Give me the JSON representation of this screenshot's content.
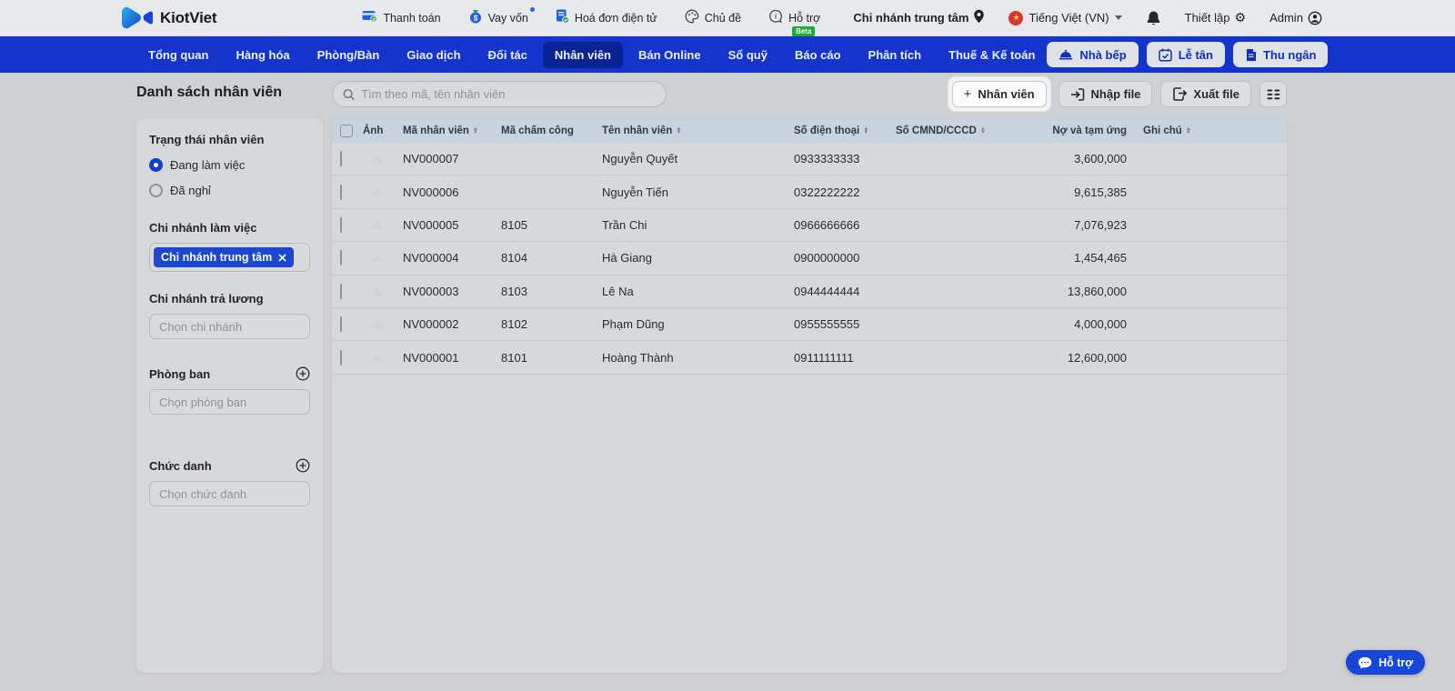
{
  "topbar": {
    "brand": "KiotViet",
    "links": [
      {
        "label": "Thanh toán"
      },
      {
        "label": "Vay vốn"
      },
      {
        "label": "Hoá đơn điện tử"
      },
      {
        "label": "Chủ đề"
      },
      {
        "label": "Hỗ trợ",
        "badge": "Beta"
      }
    ],
    "branch": "Chi nhánh trung tâm",
    "language": "Tiếng Việt (VN)",
    "settings_label": "Thiết lập",
    "user": "Admin"
  },
  "nav": {
    "items": [
      {
        "label": "Tổng quan",
        "active": false
      },
      {
        "label": "Hàng hóa",
        "active": false
      },
      {
        "label": "Phòng/Bàn",
        "active": false
      },
      {
        "label": "Giao dịch",
        "active": false
      },
      {
        "label": "Đối tác",
        "active": false
      },
      {
        "label": "Nhân viên",
        "active": true
      },
      {
        "label": "Bán Online",
        "active": false
      },
      {
        "label": "Sổ quỹ",
        "active": false
      },
      {
        "label": "Báo cáo",
        "active": false
      },
      {
        "label": "Phân tích",
        "active": false
      },
      {
        "label": "Thuế & Kế toán",
        "active": false
      }
    ],
    "quick_buttons": [
      {
        "label": "Nhà bếp",
        "icon": "kitchen-cloche-icon"
      },
      {
        "label": "Lễ tân",
        "icon": "reception-calendar-icon"
      },
      {
        "label": "Thu ngân",
        "icon": "cashier-receipt-icon"
      }
    ]
  },
  "page": {
    "title": "Danh sách nhân viên",
    "search_placeholder": "Tìm theo mã, tên nhân viên",
    "add_button": "Nhân viên",
    "import_button": "Nhập file",
    "export_button": "Xuất file"
  },
  "filters": {
    "status_title": "Trạng thái nhân viên",
    "status_options": [
      {
        "label": "Đang làm việc",
        "selected": true
      },
      {
        "label": "Đã nghỉ",
        "selected": false
      }
    ],
    "work_branch_title": "Chi nhánh làm việc",
    "work_branch_chip": "Chi nhánh trung tâm",
    "pay_branch_title": "Chi nhánh trả lương",
    "pay_branch_placeholder": "Chọn chi nhánh",
    "department_title": "Phòng ban",
    "department_placeholder": "Chọn phòng ban",
    "position_title": "Chức danh",
    "position_placeholder": "Chọn chức danh"
  },
  "table": {
    "columns": [
      {
        "label": "Ảnh"
      },
      {
        "label": "Mã nhân viên"
      },
      {
        "label": "Mã chấm công"
      },
      {
        "label": "Tên nhân viên"
      },
      {
        "label": "Số điện thoại"
      },
      {
        "label": "Số CMND/CCCD"
      },
      {
        "label": "Nợ và tạm ứng"
      },
      {
        "label": "Ghi chú"
      }
    ],
    "rows": [
      {
        "code": "NV000007",
        "timecode": "",
        "name": "Nguyễn Quyết",
        "phone": "0933333333",
        "cmnd": "",
        "debt": "3,600,000",
        "note": ""
      },
      {
        "code": "NV000006",
        "timecode": "",
        "name": "Nguyễn Tiến",
        "phone": "0322222222",
        "cmnd": "",
        "debt": "9,615,385",
        "note": ""
      },
      {
        "code": "NV000005",
        "timecode": "8105",
        "name": "Trần Chi",
        "phone": "0966666666",
        "cmnd": "",
        "debt": "7,076,923",
        "note": ""
      },
      {
        "code": "NV000004",
        "timecode": "8104",
        "name": "Hà Giang",
        "phone": "0900000000",
        "cmnd": "",
        "debt": "1,454,465",
        "note": ""
      },
      {
        "code": "NV000003",
        "timecode": "8103",
        "name": "Lê Na",
        "phone": "0944444444",
        "cmnd": "",
        "debt": "13,860,000",
        "note": ""
      },
      {
        "code": "NV000002",
        "timecode": "8102",
        "name": "Phạm Dũng",
        "phone": "0955555555",
        "cmnd": "",
        "debt": "4,000,000",
        "note": ""
      },
      {
        "code": "NV000001",
        "timecode": "8101",
        "name": "Hoàng Thành",
        "phone": "0911111111",
        "cmnd": "",
        "debt": "12,600,000",
        "note": ""
      }
    ]
  },
  "support_button": "Hỗ trợ",
  "colors": {
    "nav_blue": "#1434cb",
    "nav_active_blue": "#0a2394",
    "chip_blue": "#1b47d3",
    "beta_green": "#1fa83c",
    "flag_red": "#d8362c",
    "support_blue": "#1747d8",
    "header_row": "#c8d4dd"
  }
}
